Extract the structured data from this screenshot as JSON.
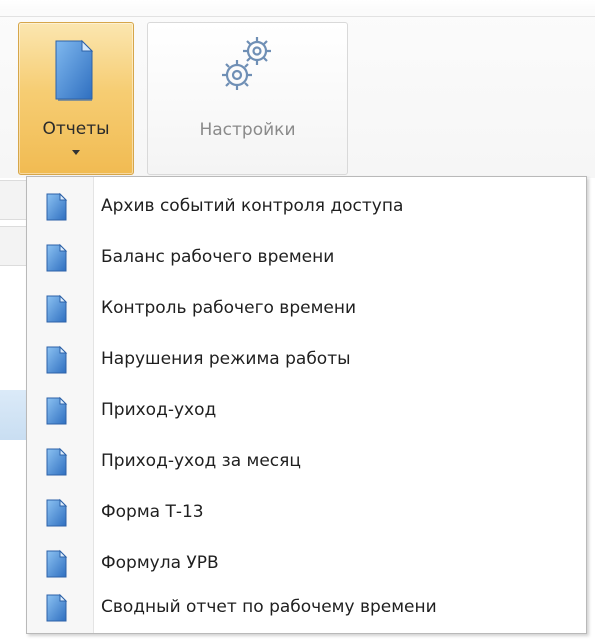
{
  "ribbon": {
    "reports_button": {
      "label": "Отчеты",
      "icon": "document-icon"
    },
    "settings_button": {
      "label": "Настройки",
      "icon": "gears-icon"
    }
  },
  "reports_menu": {
    "items": [
      {
        "label": "Архив событий контроля доступа",
        "icon": "report-icon"
      },
      {
        "label": "Баланс рабочего времени",
        "icon": "report-icon"
      },
      {
        "label": "Контроль рабочего времени",
        "icon": "report-icon"
      },
      {
        "label": "Нарушения режима работы",
        "icon": "report-icon"
      },
      {
        "label": "Приход-уход",
        "icon": "report-icon"
      },
      {
        "label": "Приход-уход за месяц",
        "icon": "report-icon"
      },
      {
        "label": "Форма Т-13",
        "icon": "report-icon"
      },
      {
        "label": "Формула УРВ",
        "icon": "report-icon"
      },
      {
        "label": "Сводный отчет по рабочему времени",
        "icon": "report-icon"
      }
    ]
  },
  "colors": {
    "active_button": "#f6cd73",
    "icon_blue": "#3f84d6",
    "menu_border": "#b9b9b9"
  }
}
